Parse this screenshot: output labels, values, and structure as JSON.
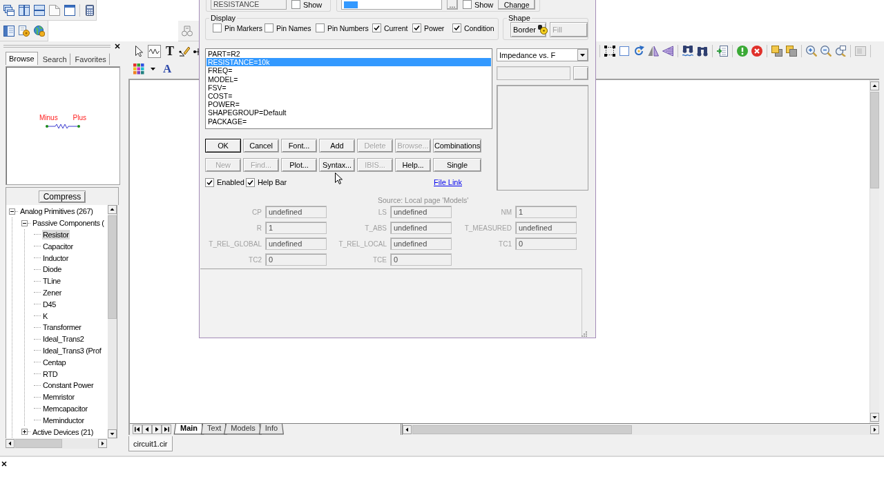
{
  "left_panel": {
    "tabs": [
      {
        "label": "Browse",
        "selected": true
      },
      {
        "label": "Search",
        "selected": false
      },
      {
        "label": "Favorites",
        "selected": false
      }
    ],
    "preview": {
      "pin_labels": [
        "Minus",
        "Plus"
      ]
    },
    "compress_button": "Compress",
    "tree": [
      {
        "label": "Analog Primitives (267)",
        "expanded": true,
        "selected": false,
        "children": [
          {
            "label": "Passive Components (",
            "expanded": true,
            "selected": false,
            "children": [
              {
                "label": "Resistor",
                "selected": true
              },
              {
                "label": "Capacitor",
                "selected": false
              },
              {
                "label": "Inductor",
                "selected": false
              },
              {
                "label": "Diode",
                "selected": false
              },
              {
                "label": "TLine",
                "selected": false
              },
              {
                "label": "Zener",
                "selected": false
              },
              {
                "label": "D45",
                "selected": false
              },
              {
                "label": "K",
                "selected": false
              },
              {
                "label": "Transformer",
                "selected": false
              },
              {
                "label": "Ideal_Trans2",
                "selected": false
              },
              {
                "label": "Ideal_Trans3 (Prof",
                "selected": false
              },
              {
                "label": "Centap",
                "selected": false
              },
              {
                "label": "RTD",
                "selected": false
              },
              {
                "label": "Constant Power",
                "selected": false
              },
              {
                "label": "Memristor",
                "selected": false
              },
              {
                "label": "Memcapacitor",
                "selected": false
              },
              {
                "label": "Meminductor",
                "selected": false
              }
            ]
          },
          {
            "label": "Active Devices (21)",
            "expanded": false,
            "selected": false
          }
        ]
      }
    ]
  },
  "canvas_toolbar": {
    "text_tool": "T",
    "font_tool": "A"
  },
  "canvas": {
    "page_tabs": [
      {
        "label": "Main",
        "selected": true
      },
      {
        "label": "Text",
        "selected": false
      },
      {
        "label": "Models",
        "selected": false
      },
      {
        "label": "Info",
        "selected": false
      }
    ],
    "document_tabs": [
      {
        "label": "circuit1.cir",
        "selected": true
      }
    ]
  },
  "dialog": {
    "name_field": {
      "value": "RESISTANCE",
      "show": {
        "label": "Show",
        "checked": false
      }
    },
    "value_field": {
      "text_selected": true,
      "browse_button": "...",
      "show": {
        "label": "Show",
        "checked": false
      },
      "change_button": "Change"
    },
    "display": {
      "title": "Display",
      "options": [
        {
          "label": "Pin Markers",
          "checked": false
        },
        {
          "label": "Pin Names",
          "checked": false
        },
        {
          "label": "Pin Numbers",
          "checked": false
        },
        {
          "label": "Current",
          "checked": true
        },
        {
          "label": "Power",
          "checked": true
        },
        {
          "label": "Condition",
          "checked": true
        }
      ]
    },
    "shape": {
      "title": "Shape",
      "buttons": [
        {
          "label": "Border",
          "disabled": false
        },
        {
          "label": "Fill",
          "disabled": true
        }
      ]
    },
    "attributes": [
      {
        "text": "PART=R2",
        "selected": false
      },
      {
        "text": "RESISTANCE=10k",
        "selected": true
      },
      {
        "text": "FREQ=",
        "selected": false
      },
      {
        "text": "MODEL=",
        "selected": false
      },
      {
        "text": "FSV=",
        "selected": false
      },
      {
        "text": "COST=",
        "selected": false
      },
      {
        "text": "POWER=",
        "selected": false
      },
      {
        "text": "SHAPEGROUP=Default",
        "selected": false
      },
      {
        "text": "PACKAGE=",
        "selected": false
      }
    ],
    "plot_select": {
      "value": "Impedance vs. F"
    },
    "button_rows": [
      [
        {
          "label": "OK",
          "disabled": false,
          "default": true
        },
        {
          "label": "Cancel",
          "disabled": false,
          "default": false
        },
        {
          "label": "Font...",
          "disabled": false,
          "default": false
        },
        {
          "label": "Add",
          "disabled": false,
          "default": false
        },
        {
          "label": "Delete",
          "disabled": true,
          "default": false
        },
        {
          "label": "Browse...",
          "disabled": true,
          "default": false
        },
        {
          "label": "Combinations",
          "disabled": false,
          "default": false
        }
      ],
      [
        {
          "label": "New",
          "disabled": true,
          "default": false
        },
        {
          "label": "Find...",
          "disabled": true,
          "default": false
        },
        {
          "label": "Plot...",
          "disabled": false,
          "default": false
        },
        {
          "label": "Syntax...",
          "disabled": false,
          "default": false
        },
        {
          "label": "IBIS...",
          "disabled": true,
          "default": false
        },
        {
          "label": "Help...",
          "disabled": false,
          "default": false
        },
        {
          "label": "Single",
          "disabled": false,
          "default": false
        }
      ]
    ],
    "options": [
      {
        "label": "Enabled",
        "checked": true
      },
      {
        "label": "Help Bar",
        "checked": true
      }
    ],
    "file_link": "File Link",
    "source": "Source: Local page 'Models'",
    "parameters": [
      {
        "name": "CP",
        "value": "undefined",
        "disabled": true
      },
      {
        "name": "LS",
        "value": "undefined",
        "disabled": true
      },
      {
        "name": "NM",
        "value": "1",
        "disabled": true
      },
      {
        "name": "R",
        "value": "1",
        "disabled": true
      },
      {
        "name": "T_ABS",
        "value": "undefined",
        "disabled": true
      },
      {
        "name": "T_MEASURED",
        "value": "undefined",
        "disabled": true
      },
      {
        "name": "T_REL_GLOBAL",
        "value": "undefined",
        "disabled": true
      },
      {
        "name": "T_REL_LOCAL",
        "value": "undefined",
        "disabled": true
      },
      {
        "name": "TC1",
        "value": "0",
        "disabled": true
      },
      {
        "name": "TC2",
        "value": "0",
        "disabled": true
      },
      {
        "name": "TCE",
        "value": "0",
        "disabled": true
      }
    ]
  }
}
